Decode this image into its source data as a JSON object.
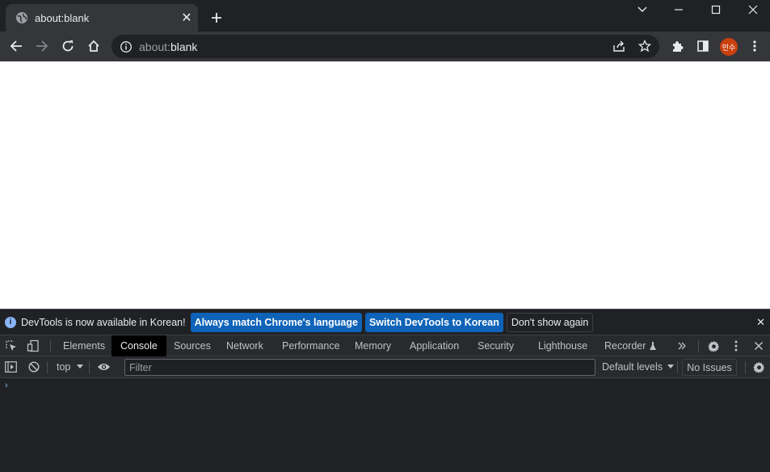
{
  "tab": {
    "title": "about:blank",
    "close": "✕"
  },
  "omnibox": {
    "url_prefix": "about:",
    "url_main": "blank"
  },
  "profile": {
    "avatar_text": "민수",
    "color": "#c9410f"
  },
  "infobar": {
    "message": "DevTools is now available in Korean!",
    "btn_match": "Always match Chrome's language",
    "btn_switch": "Switch DevTools to Korean",
    "btn_dont_show": "Don't show again",
    "close": "✕"
  },
  "devtools_tabs": [
    {
      "label": "Elements"
    },
    {
      "label": "Console"
    },
    {
      "label": "Sources"
    },
    {
      "label": "Network"
    },
    {
      "label": "Performance"
    },
    {
      "label": "Memory"
    },
    {
      "label": "Application"
    },
    {
      "label": "Security"
    },
    {
      "label": "Lighthouse"
    },
    {
      "label": "Recorder"
    }
  ],
  "active_tab": "Console",
  "console_toolbar": {
    "context": "top",
    "filter_placeholder": "Filter",
    "levels": "Default levels",
    "issues": "No Issues"
  },
  "console": {
    "prompt": "›"
  },
  "colors": {
    "accent": "#8ab4f8",
    "button_blue": "#0e63b8",
    "page_bg": "#ffffff"
  }
}
